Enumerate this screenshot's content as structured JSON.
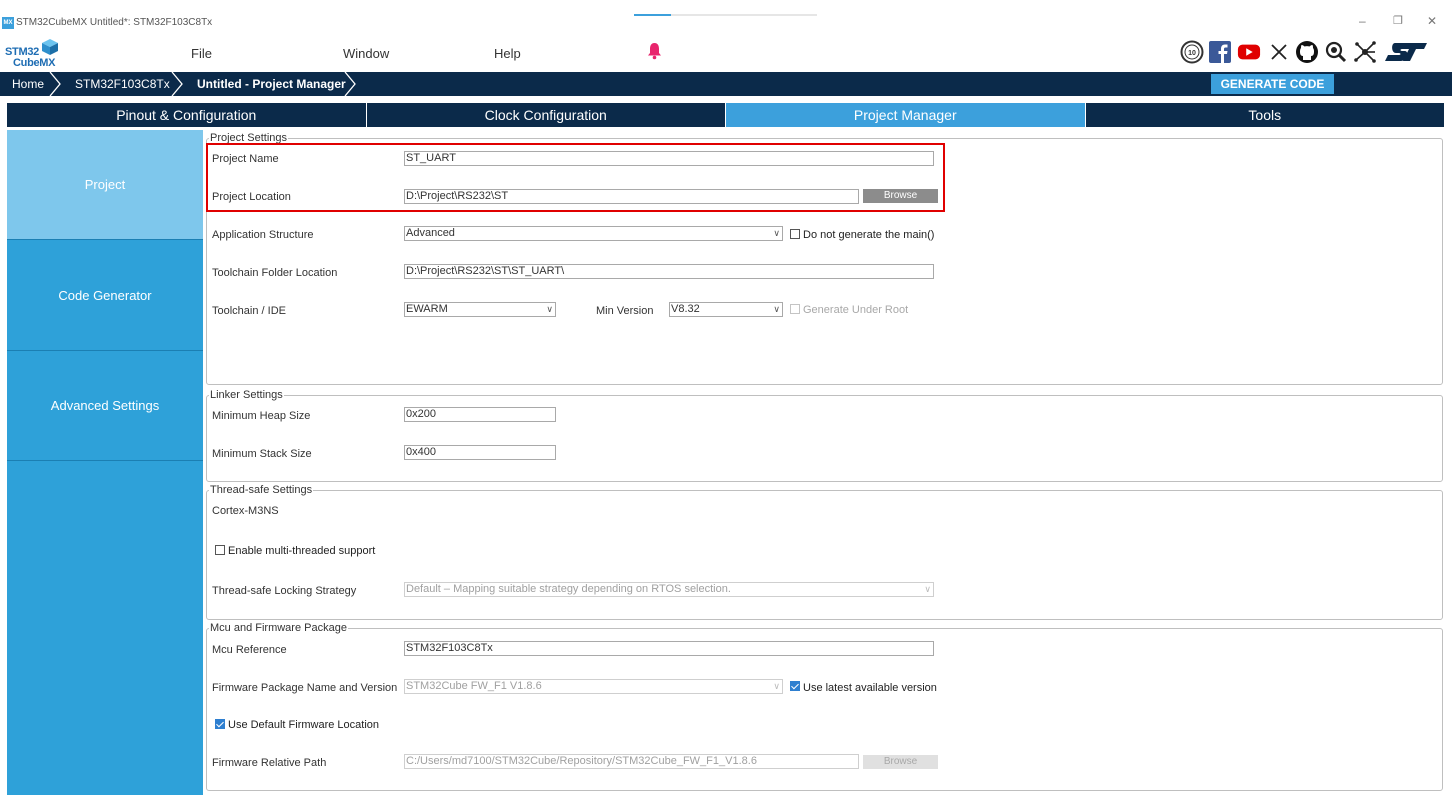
{
  "window": {
    "app_icon_text": "MX",
    "title": "STM32CubeMX Untitled*: STM32F103C8Tx",
    "progress_fraction": 0.2,
    "controls": {
      "minimize": "–",
      "restore": "❐",
      "close": "✕"
    }
  },
  "logo": {
    "line1": "STM32",
    "line2": "CubeMX"
  },
  "menu": {
    "file": "File",
    "window": "Window",
    "help": "Help"
  },
  "social_icons": [
    "10-years-icon",
    "facebook-icon",
    "youtube-icon",
    "x-icon",
    "github-icon",
    "search-community-icon",
    "network-icon",
    "st-logo-icon"
  ],
  "breadcrumb": {
    "home": "Home",
    "device": "STM32F103C8Tx",
    "current": "Untitled - Project Manager"
  },
  "generate_code": "GENERATE CODE",
  "tabs": [
    {
      "label": "Pinout & Configuration"
    },
    {
      "label": "Clock Configuration"
    },
    {
      "label": "Project Manager"
    },
    {
      "label": "Tools"
    }
  ],
  "sidebar": {
    "project": "Project",
    "code_generator": "Code Generator",
    "advanced_settings": "Advanced Settings"
  },
  "project_settings": {
    "title": "Project Settings",
    "project_name_label": "Project Name",
    "project_name_value": "ST_UART",
    "project_location_label": "Project Location",
    "project_location_value": "D:\\Project\\RS232\\ST",
    "browse": "Browse",
    "app_structure_label": "Application Structure",
    "app_structure_value": "Advanced",
    "no_main_label": "Do not generate the main()",
    "toolchain_folder_label": "Toolchain Folder Location",
    "toolchain_folder_value": "D:\\Project\\RS232\\ST\\ST_UART\\",
    "toolchain_ide_label": "Toolchain / IDE",
    "toolchain_ide_value": "EWARM",
    "min_version_label": "Min Version",
    "min_version_value": "V8.32",
    "generate_under_root_label": "Generate Under Root"
  },
  "linker_settings": {
    "title": "Linker Settings",
    "heap_label": "Minimum Heap Size",
    "heap_value": "0x200",
    "stack_label": "Minimum Stack Size",
    "stack_value": "0x400"
  },
  "thread_safe": {
    "title": "Thread-safe Settings",
    "core": "Cortex-M3NS",
    "enable_label": "Enable multi-threaded support",
    "strategy_label": "Thread-safe Locking Strategy",
    "strategy_value": "Default – Mapping suitable strategy depending on RTOS selection."
  },
  "mcu_firmware": {
    "title": "Mcu and Firmware Package",
    "mcu_ref_label": "Mcu Reference",
    "mcu_ref_value": "STM32F103C8Tx",
    "fw_pkg_label": "Firmware Package Name and Version",
    "fw_pkg_value": "STM32Cube FW_F1 V1.8.6",
    "use_latest_label": "Use latest available version",
    "use_default_loc_label": "Use Default Firmware Location",
    "fw_rel_path_label": "Firmware Relative Path",
    "fw_rel_path_value": "C:/Users/md7100/STM32Cube/Repository/STM32Cube_FW_F1_V1.8.6",
    "browse": "Browse"
  },
  "colors": {
    "navy": "#0b2a4a",
    "accent": "#3ca0dc",
    "sidebar": "#2ea1d9",
    "sidebar_active": "#7ec7ec",
    "highlight": "#e00000"
  }
}
